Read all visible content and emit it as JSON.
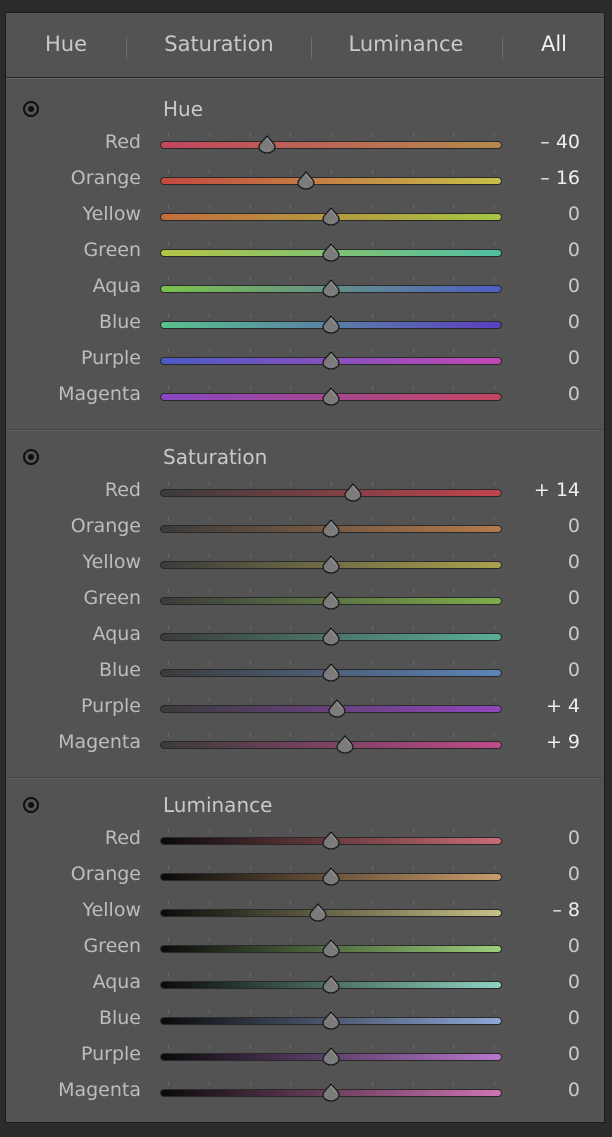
{
  "tabs": [
    {
      "label": "Hue",
      "active": false
    },
    {
      "label": "Saturation",
      "active": false
    },
    {
      "label": "Luminance",
      "active": false
    },
    {
      "label": "All",
      "active": true
    }
  ],
  "icons": {
    "target_adjust": "target-icon",
    "slider_thumb": "slider-thumb-icon"
  },
  "sections": [
    {
      "title": "Hue",
      "rows": [
        {
          "label": "Red",
          "value": -40,
          "display": "– 40",
          "gradient": [
            "#c2455d",
            "#b48a4c"
          ]
        },
        {
          "label": "Orange",
          "value": -16,
          "display": "– 16",
          "gradient": [
            "#c4473f",
            "#c6c04a"
          ]
        },
        {
          "label": "Yellow",
          "value": 0,
          "display": "0",
          "gradient": [
            "#c46c3c",
            "#a5c642"
          ]
        },
        {
          "label": "Green",
          "value": 0,
          "display": "0",
          "gradient": [
            "#b5c446",
            "#4fbfa2"
          ]
        },
        {
          "label": "Aqua",
          "value": 0,
          "display": "0",
          "gradient": [
            "#7cc34c",
            "#4c5ec4"
          ]
        },
        {
          "label": "Blue",
          "value": 0,
          "display": "0",
          "gradient": [
            "#58c28d",
            "#5a3ec2"
          ]
        },
        {
          "label": "Purple",
          "value": 0,
          "display": "0",
          "gradient": [
            "#4a5ac6",
            "#c447b3"
          ]
        },
        {
          "label": "Magenta",
          "value": 0,
          "display": "0",
          "gradient": [
            "#8947c4",
            "#c4455e"
          ]
        }
      ]
    },
    {
      "title": "Saturation",
      "rows": [
        {
          "label": "Red",
          "value": 14,
          "display": "+ 14",
          "gradient": [
            "#3b3b3b",
            "#c2444e"
          ]
        },
        {
          "label": "Orange",
          "value": 0,
          "display": "0",
          "gradient": [
            "#3b3b3b",
            "#b57a4a"
          ]
        },
        {
          "label": "Yellow",
          "value": 0,
          "display": "0",
          "gradient": [
            "#3b3b3b",
            "#aaa24e"
          ]
        },
        {
          "label": "Green",
          "value": 0,
          "display": "0",
          "gradient": [
            "#3b3b3b",
            "#7eae4b"
          ]
        },
        {
          "label": "Aqua",
          "value": 0,
          "display": "0",
          "gradient": [
            "#3b3b3b",
            "#5aae98"
          ]
        },
        {
          "label": "Blue",
          "value": 0,
          "display": "0",
          "gradient": [
            "#3b3b3b",
            "#5c85b8"
          ]
        },
        {
          "label": "Purple",
          "value": 4,
          "display": "+ 4",
          "gradient": [
            "#3b3b3b",
            "#9146c0"
          ]
        },
        {
          "label": "Magenta",
          "value": 9,
          "display": "+ 9",
          "gradient": [
            "#3b3b3b",
            "#bf4a8a"
          ]
        }
      ]
    },
    {
      "title": "Luminance",
      "rows": [
        {
          "label": "Red",
          "value": 0,
          "display": "0",
          "gradient": [
            "#0a0a0a",
            "#c96c76"
          ]
        },
        {
          "label": "Orange",
          "value": 0,
          "display": "0",
          "gradient": [
            "#0a0a0a",
            "#c99c6c"
          ]
        },
        {
          "label": "Yellow",
          "value": -8,
          "display": "– 8",
          "gradient": [
            "#0a0a0a",
            "#c8c188"
          ]
        },
        {
          "label": "Green",
          "value": 0,
          "display": "0",
          "gradient": [
            "#0a0a0a",
            "#9cd07a"
          ]
        },
        {
          "label": "Aqua",
          "value": 0,
          "display": "0",
          "gradient": [
            "#0a0a0a",
            "#8ed2c1"
          ]
        },
        {
          "label": "Blue",
          "value": 0,
          "display": "0",
          "gradient": [
            "#0a0a0a",
            "#8fa7d6"
          ]
        },
        {
          "label": "Purple",
          "value": 0,
          "display": "0",
          "gradient": [
            "#0a0a0a",
            "#b777cf"
          ]
        },
        {
          "label": "Magenta",
          "value": 0,
          "display": "0",
          "gradient": [
            "#0a0a0a",
            "#cf74b2"
          ]
        }
      ]
    }
  ],
  "slider_range": [
    -100,
    100
  ],
  "colors": {
    "panel_bg": "#535353",
    "text": "#c9c9c9",
    "thumb": "#7a7a7a"
  }
}
